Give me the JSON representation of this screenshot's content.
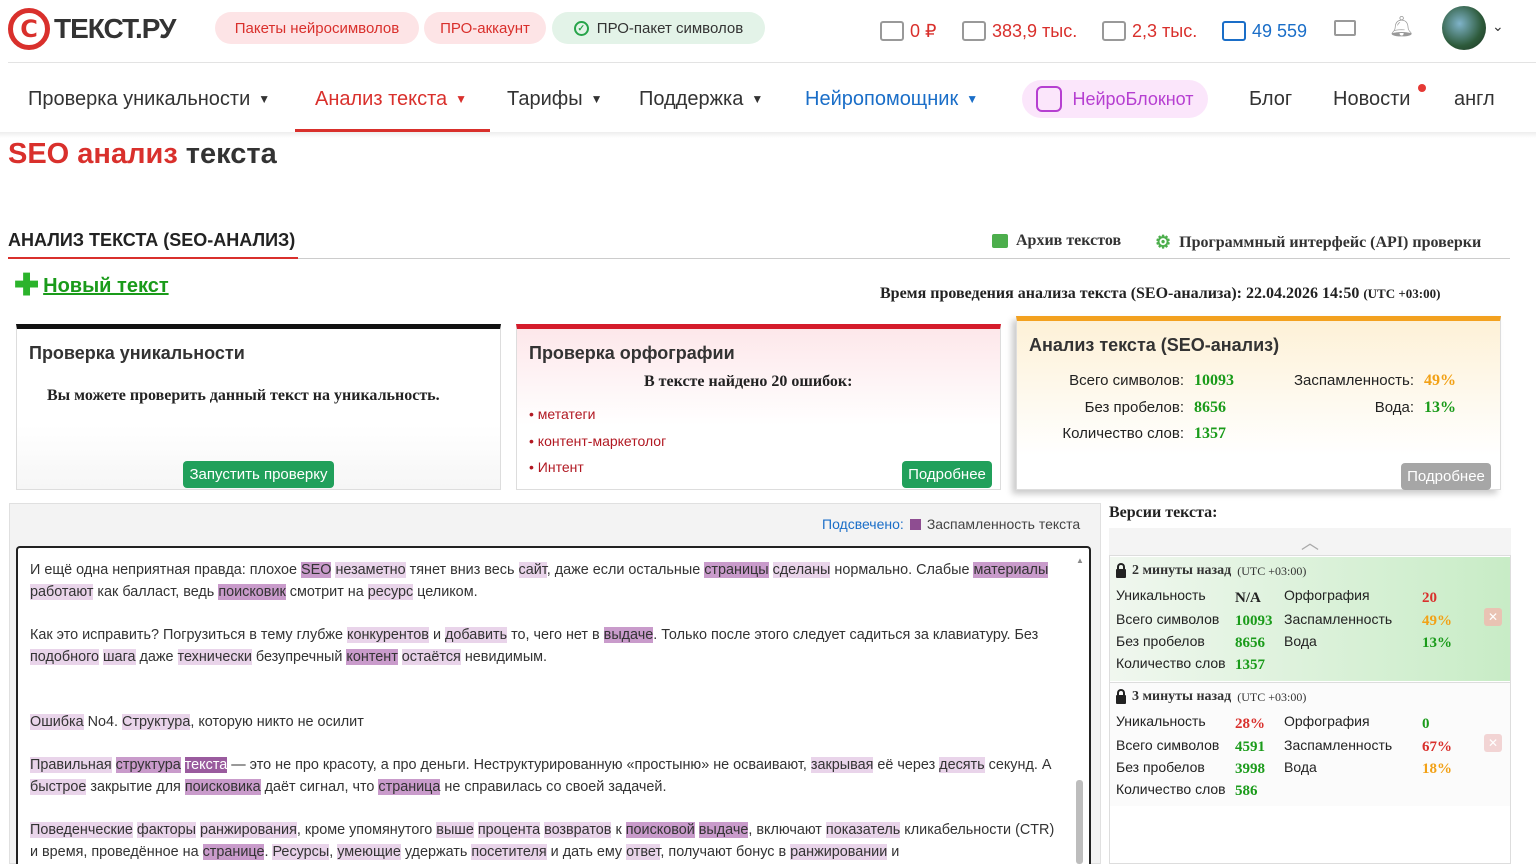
{
  "logo": {
    "mark": "C",
    "text": "ТЕКСТ.РУ"
  },
  "header": {
    "pills": [
      "Пакеты нейросимволов",
      "ПРО-аккаунт",
      "ПРО-пакет символов"
    ],
    "balance": "0 ₽",
    "symbols": "383,9 тыс.",
    "calendar": "2,3 тыс.",
    "counter": "49 559"
  },
  "nav": {
    "items": [
      "Проверка уникальности",
      "Анализ текста",
      "Тарифы",
      "Поддержка",
      "Нейропомощник"
    ],
    "neuro": "НейроБлокнот",
    "blog": "Блог",
    "news": "Новости",
    "lang": "англ"
  },
  "page": {
    "title_red": "SEO анализ",
    "title_dark": " текста",
    "section_title": "АНАЛИЗ ТЕКСТА (SEO-АНАЛИЗ)",
    "archive": "Архив текстов",
    "api": "Программный интерфейс (API) проверки",
    "new_text": "Новый текст",
    "time_label": "Время проведения анализа текста (SEO-анализа): 22.04.2026 14:50",
    "time_tz": "(UTC +03:00)"
  },
  "cards": {
    "uniq": {
      "title": "Проверка уникальности",
      "text": "Вы можете проверить данный текст на уникальность.",
      "button": "Запустить проверку"
    },
    "spell": {
      "title": "Проверка орфографии",
      "subtitle": "В тексте найдено 20 ошибок:",
      "errors": [
        "метатеги",
        "контент-маркетолог",
        "Интент"
      ],
      "button": "Подробнее"
    },
    "seo": {
      "title": "Анализ текста (SEO-анализ)",
      "labels": [
        "Всего символов:",
        "Без пробелов:",
        "Количество слов:",
        "Заспамленность:",
        "Вода:"
      ],
      "values": [
        "10093",
        "8656",
        "1357",
        "49%",
        "13%"
      ],
      "button": "Подробнее"
    }
  },
  "editor": {
    "highlight_label": "Подсвечено:",
    "highlight_value": "Заспамленность текста"
  },
  "versions": {
    "title": "Версии текста:",
    "labels": [
      "Уникальность",
      "Всего символов",
      "Без пробелов",
      "Количество слов",
      "Орфография",
      "Заспамленность",
      "Вода"
    ],
    "items": [
      {
        "time": "2 минуты назад",
        "tz": "(UTC +03:00)",
        "uniq": "N/A",
        "total": "10093",
        "nospace": "8656",
        "words": "1357",
        "spell": "20",
        "spam": "49%",
        "water": "13%"
      },
      {
        "time": "3 минуты назад",
        "tz": "(UTC +03:00)",
        "uniq": "28%",
        "total": "4591",
        "nospace": "3998",
        "words": "586",
        "spell": "0",
        "spam": "67%",
        "water": "18%"
      }
    ]
  }
}
